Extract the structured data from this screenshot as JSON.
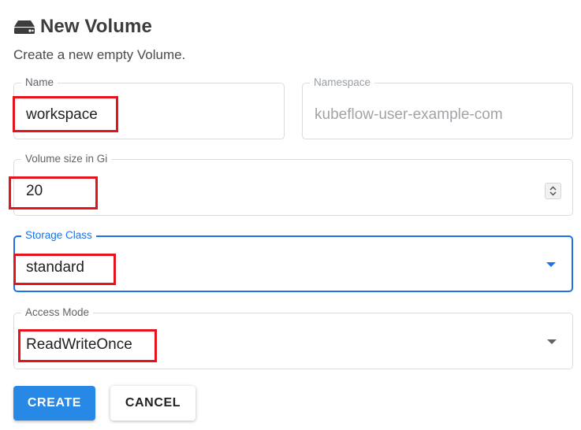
{
  "header": {
    "icon": "storage-drive-icon",
    "title": "New Volume",
    "subtitle": "Create a new empty Volume."
  },
  "form": {
    "name": {
      "label": "Name",
      "value": "workspace"
    },
    "namespace": {
      "label": "Namespace",
      "value": "kubeflow-user-example-com",
      "disabled": true
    },
    "size": {
      "label": "Volume size in Gi",
      "value": "20",
      "icon": "number-stepper-icon"
    },
    "storage_class": {
      "label": "Storage Class",
      "value": "standard",
      "focused": true,
      "icon": "dropdown-arrow-icon"
    },
    "access_mode": {
      "label": "Access Mode",
      "value": "ReadWriteOnce",
      "icon": "dropdown-arrow-icon"
    }
  },
  "actions": {
    "create_label": "CREATE",
    "cancel_label": "CANCEL"
  },
  "colors": {
    "accent": "#1a73e8",
    "primary_button": "#2788e6",
    "highlight_box": "#e3141b"
  }
}
